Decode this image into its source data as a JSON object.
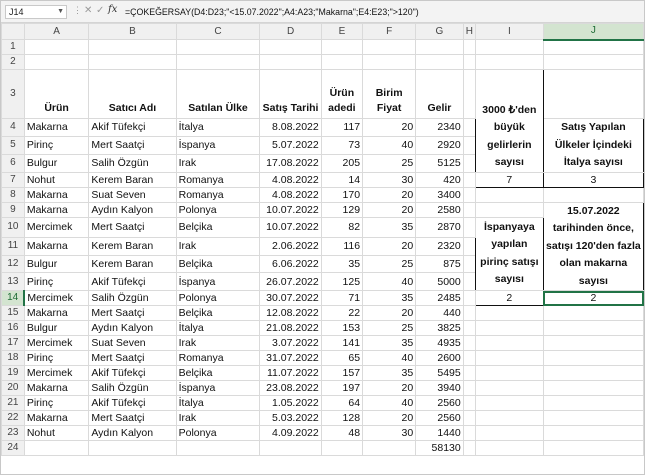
{
  "formula_bar": {
    "name_box": "J14",
    "fx": "fx",
    "formula": "=ÇOKEĞERSAY(D4:D23;\"<15.07.2022\";A4:A23;\"Makarna\";E4:E23;\">120\")"
  },
  "columns": [
    "A",
    "B",
    "C",
    "D",
    "E",
    "F",
    "G",
    "H",
    "I",
    "J"
  ],
  "rows": [
    "1",
    "2",
    "3",
    "4",
    "5",
    "6",
    "7",
    "8",
    "9",
    "10",
    "11",
    "12",
    "13",
    "14",
    "15",
    "16",
    "17",
    "18",
    "19",
    "20",
    "21",
    "22",
    "23",
    "24"
  ],
  "headers": {
    "urun": "Ürün",
    "satici": "Satıcı Adı",
    "ulke": "Satılan Ülke",
    "tarih": "Satış Tarihi",
    "adet": "Ürün adedi",
    "fiyat": "Birim Fiyat",
    "gelir": "Gelir"
  },
  "table": [
    [
      "Makarna",
      "Akif Tüfekçi",
      "İtalya",
      "8.08.2022",
      "117",
      "20",
      "2340"
    ],
    [
      "Pirinç",
      "Mert Saatçi",
      "İspanya",
      "5.07.2022",
      "73",
      "40",
      "2920"
    ],
    [
      "Bulgur",
      "Salih Özgün",
      "Irak",
      "17.08.2022",
      "205",
      "25",
      "5125"
    ],
    [
      "Nohut",
      "Kerem Baran",
      "Romanya",
      "4.08.2022",
      "14",
      "30",
      "420"
    ],
    [
      "Makarna",
      "Suat Seven",
      "Romanya",
      "4.08.2022",
      "170",
      "20",
      "3400"
    ],
    [
      "Makarna",
      "Aydın Kalyon",
      "Polonya",
      "10.07.2022",
      "129",
      "20",
      "2580"
    ],
    [
      "Mercimek",
      "Mert Saatçi",
      "Belçika",
      "10.07.2022",
      "82",
      "35",
      "2870"
    ],
    [
      "Makarna",
      "Kerem Baran",
      "Irak",
      "2.06.2022",
      "116",
      "20",
      "2320"
    ],
    [
      "Bulgur",
      "Kerem Baran",
      "Belçika",
      "6.06.2022",
      "35",
      "25",
      "875"
    ],
    [
      "Pirinç",
      "Akif Tüfekçi",
      "İspanya",
      "26.07.2022",
      "125",
      "40",
      "5000"
    ],
    [
      "Mercimek",
      "Salih Özgün",
      "Polonya",
      "30.07.2022",
      "71",
      "35",
      "2485"
    ],
    [
      "Makarna",
      "Mert Saatçi",
      "Belçika",
      "12.08.2022",
      "22",
      "20",
      "440"
    ],
    [
      "Bulgur",
      "Aydın Kalyon",
      "İtalya",
      "21.08.2022",
      "153",
      "25",
      "3825"
    ],
    [
      "Mercimek",
      "Suat Seven",
      "Irak",
      "3.07.2022",
      "141",
      "35",
      "4935"
    ],
    [
      "Pirinç",
      "Mert Saatçi",
      "Romanya",
      "31.07.2022",
      "65",
      "40",
      "2600"
    ],
    [
      "Mercimek",
      "Akif Tüfekçi",
      "Belçika",
      "11.07.2022",
      "157",
      "35",
      "5495"
    ],
    [
      "Makarna",
      "Salih Özgün",
      "İspanya",
      "23.08.2022",
      "197",
      "20",
      "3940"
    ],
    [
      "Pirinç",
      "Akif Tüfekçi",
      "İtalya",
      "1.05.2022",
      "64",
      "40",
      "2560"
    ],
    [
      "Makarna",
      "Mert Saatçi",
      "Irak",
      "5.03.2022",
      "128",
      "20",
      "2560"
    ],
    [
      "Nohut",
      "Aydın Kalyon",
      "Polonya",
      "4.09.2022",
      "48",
      "30",
      "1440"
    ]
  ],
  "total": "58130",
  "boxes": {
    "i_top": "3000 ₺'den büyük gelirlerin sayısı",
    "i_top_val": "7",
    "j_top": "Satış Yapılan Ülkeler İçindeki İtalya sayısı",
    "j_top_val": "3",
    "i_bottom": "İspanyaya yapılan pirinç satışı sayısı",
    "i_bottom_val": "2",
    "j_bottom": "15.07.2022 tarihinden önce, satışı 120'den fazla olan makarna sayısı",
    "j_bottom_val": "2"
  }
}
